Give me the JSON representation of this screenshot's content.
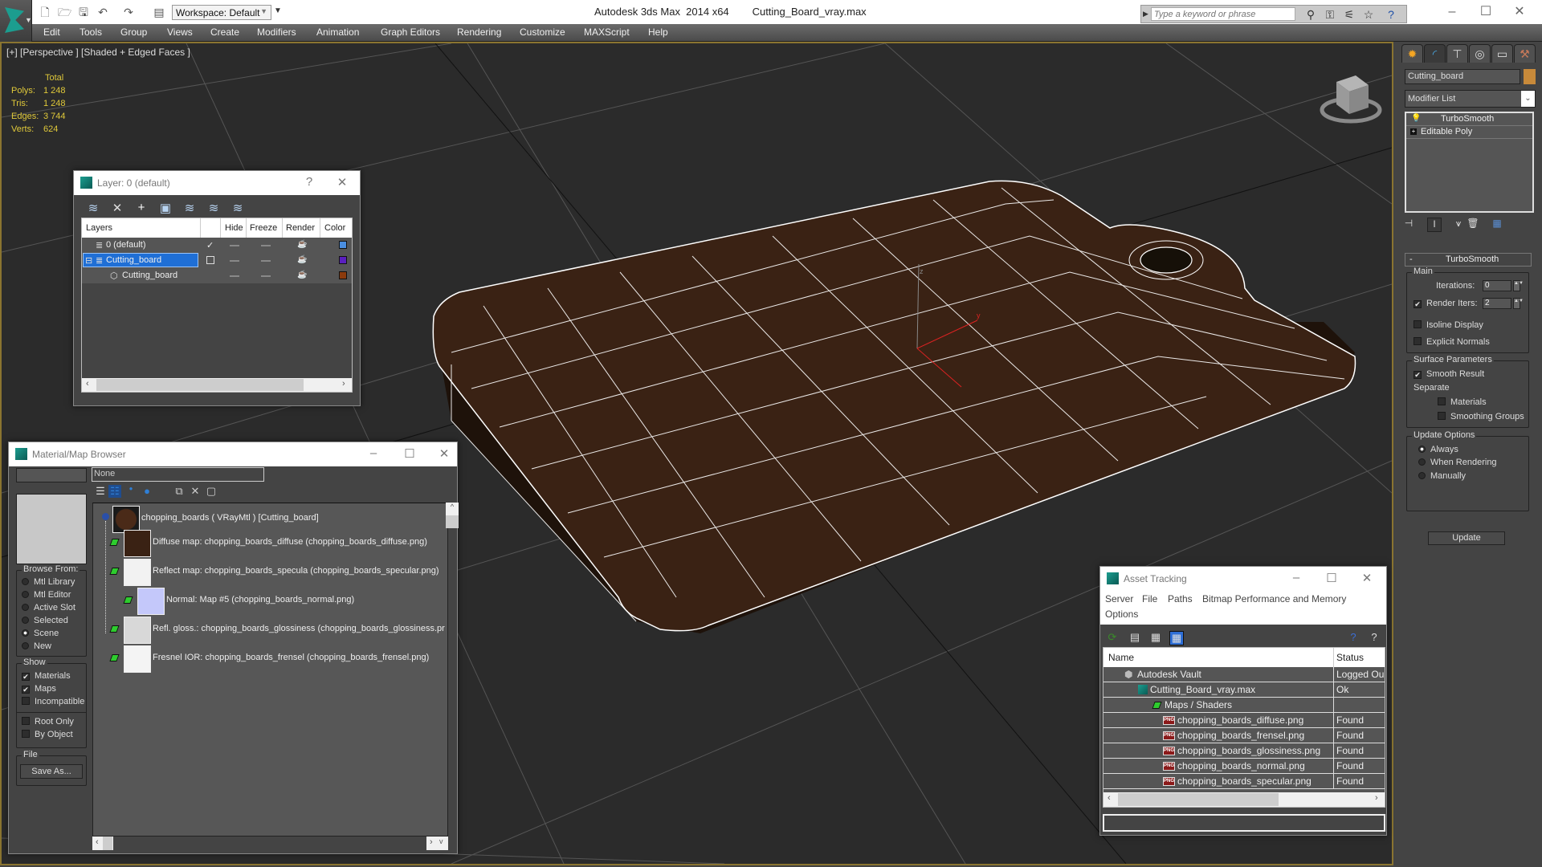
{
  "titlebar": {
    "app_title": "Autodesk 3ds Max  2014 x64",
    "file_name": "Cutting_Board_vray.max",
    "workspace_label": "Workspace: Default",
    "search_placeholder": "Type a keyword or phrase",
    "quick_access": [
      "new-file",
      "open-file",
      "save-file",
      "undo",
      "redo",
      "project-folder"
    ],
    "window_controls": {
      "minimize": "–",
      "maximize": "☐",
      "close": "✕"
    }
  },
  "menu": [
    "Edit",
    "Tools",
    "Group",
    "Views",
    "Create",
    "Modifiers",
    "Animation",
    "Graph Editors",
    "Rendering",
    "Customize",
    "MAXScript",
    "Help"
  ],
  "viewport": {
    "label": "[+] [Perspective ] [Shaded + Edged Faces ]",
    "stats": {
      "header": "Total",
      "rows": [
        {
          "label": "Polys:",
          "value": "1 248"
        },
        {
          "label": "Tris:",
          "value": "1 248"
        },
        {
          "label": "Edges:",
          "value": "3 744"
        },
        {
          "label": "Verts:",
          "value": "624"
        }
      ]
    },
    "object_color": "#3a2214",
    "wire_color": "#ffffff",
    "gizmo_axis_label": "z",
    "gizmo_y_label": "y"
  },
  "layer_dialog": {
    "title": "Layer: 0 (default)",
    "help": "?",
    "close": "✕",
    "columns": [
      "Layers",
      "Hide",
      "Freeze",
      "Render",
      "Color"
    ],
    "rows": [
      {
        "name": "0 (default)",
        "active": "✓",
        "color": "#4a8ee0"
      },
      {
        "name": "Cutting_board",
        "active": "",
        "color": "#5a1fbf",
        "selected": true
      },
      {
        "name": "Cutting_board",
        "active": "",
        "color": "#8b3a0c"
      }
    ]
  },
  "material_browser": {
    "title": "Material/Map Browser",
    "filter_value": "None",
    "browse_from": {
      "label": "Browse From:",
      "options": [
        "Mtl Library",
        "Mtl Editor",
        "Active Slot",
        "Selected",
        "Scene",
        "New"
      ],
      "selected": "Scene"
    },
    "show": {
      "label": "Show",
      "options": [
        {
          "label": "Materials",
          "checked": true
        },
        {
          "label": "Maps",
          "checked": true
        },
        {
          "label": "Incompatible",
          "checked": false
        }
      ],
      "extra": [
        {
          "label": "Root Only",
          "checked": false
        },
        {
          "label": "By Object",
          "checked": false
        }
      ]
    },
    "file": {
      "label": "File",
      "save_as": "Save As..."
    },
    "tree": {
      "root": "chopping_boards  ( VRayMtl )  [Cutting_board]",
      "maps": [
        {
          "label": "Diffuse map: chopping_boards_diffuse (chopping_boards_diffuse.png)",
          "thumb": "#3a2214"
        },
        {
          "label": "Reflect map: chopping_boards_specula (chopping_boards_specular.png)",
          "thumb": "#f2f2f2"
        },
        {
          "label": "Normal: Map #5 (chopping_boards_normal.png)",
          "thumb": "#c4c8fa"
        },
        {
          "label": "Refl. gloss.: chopping_boards_glossiness (chopping_boards_glossiness.pr",
          "thumb": "#d8d8d8"
        },
        {
          "label": "Fresnel IOR: chopping_boards_frensel (chopping_boards_frensel.png)",
          "thumb": "#f4f4f4"
        }
      ]
    }
  },
  "asset_tracking": {
    "title": "Asset Tracking",
    "menu": [
      "Server",
      "File",
      "Paths",
      "Bitmap Performance and Memory",
      "Options"
    ],
    "columns": [
      "Name",
      "Status"
    ],
    "rows": [
      {
        "name": "Autodesk Vault",
        "status": "Logged Ou",
        "indent": 1,
        "icon": "vault"
      },
      {
        "name": "Cutting_Board_vray.max",
        "status": "Ok",
        "indent": 2,
        "icon": "max"
      },
      {
        "name": "Maps / Shaders",
        "status": "",
        "indent": 3,
        "icon": "maps"
      },
      {
        "name": "chopping_boards_diffuse.png",
        "status": "Found",
        "indent": 4,
        "icon": "png"
      },
      {
        "name": "chopping_boards_frensel.png",
        "status": "Found",
        "indent": 4,
        "icon": "png"
      },
      {
        "name": "chopping_boards_glossiness.png",
        "status": "Found",
        "indent": 4,
        "icon": "png"
      },
      {
        "name": "chopping_boards_normal.png",
        "status": "Found",
        "indent": 4,
        "icon": "png"
      },
      {
        "name": "chopping_boards_specular.png",
        "status": "Found",
        "indent": 4,
        "icon": "png"
      }
    ]
  },
  "command_panel": {
    "tabs": [
      "create",
      "modify",
      "hierarchy",
      "motion",
      "display",
      "utilities"
    ],
    "active_tab": "modify",
    "object_name": "Cutting_board",
    "object_color": "#c88a3a",
    "modifier_list_label": "Modifier List",
    "stack": [
      "TurboSmooth",
      "Editable Poly"
    ],
    "rollout": {
      "title": "TurboSmooth",
      "main_label": "Main",
      "iterations_label": "Iterations:",
      "iterations_value": "0",
      "render_iters_label": "Render Iters:",
      "render_iters_value": "2",
      "render_iters_checked": true,
      "isoline_label": "Isoline Display",
      "isoline_checked": false,
      "explicit_label": "Explicit Normals",
      "explicit_checked": false,
      "surface_label": "Surface Parameters",
      "smooth_result_label": "Smooth Result",
      "smooth_result_checked": true,
      "separate_label": "Separate",
      "materials_label": "Materials",
      "smoothing_groups_label": "Smoothing Groups",
      "update_options_label": "Update Options",
      "update_options": [
        "Always",
        "When Rendering",
        "Manually"
      ],
      "update_selected": "Always",
      "update_button": "Update"
    }
  }
}
